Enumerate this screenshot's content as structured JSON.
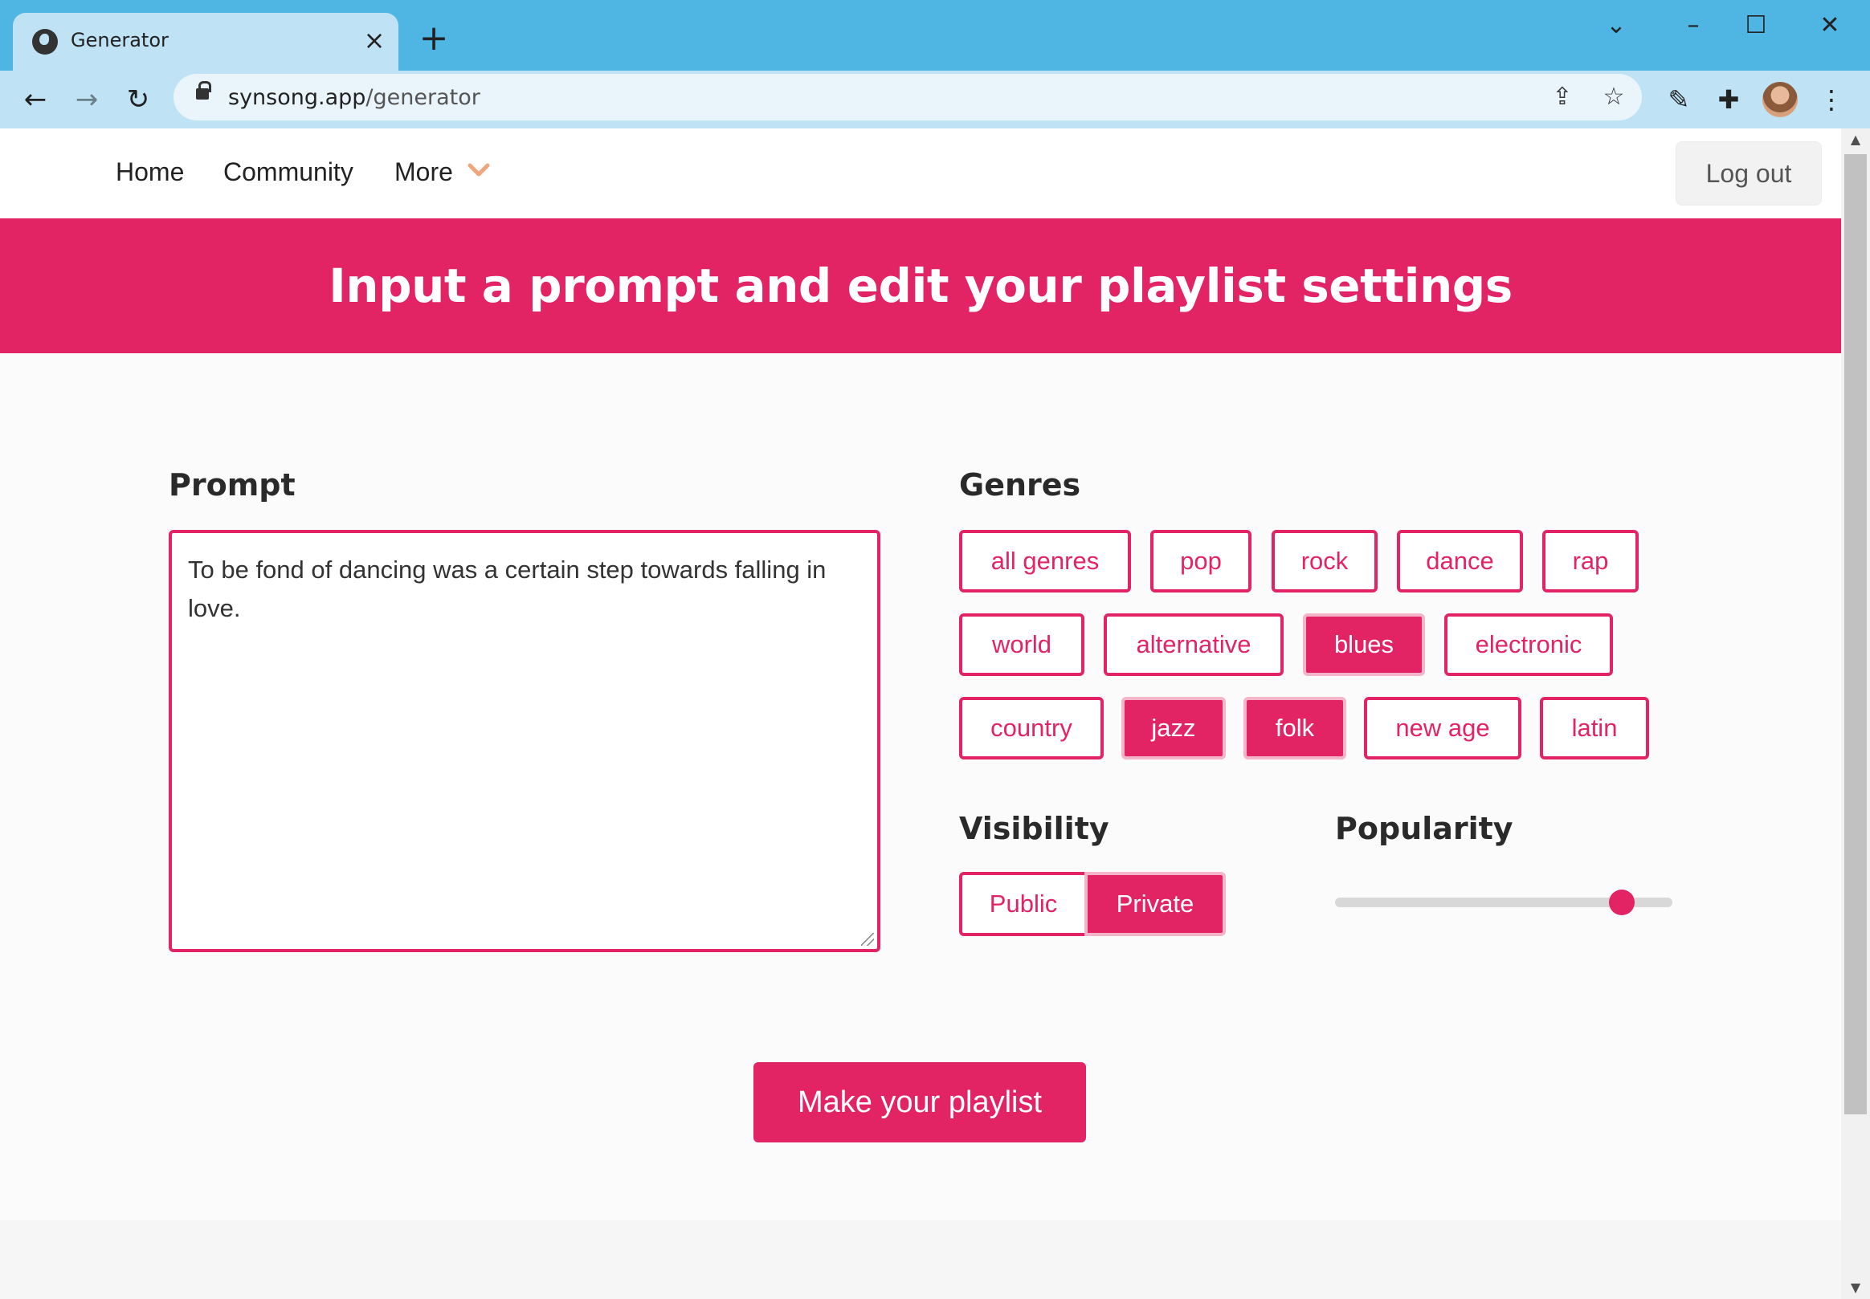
{
  "browser": {
    "tab_title": "Generator",
    "url_domain": "synsong.app",
    "url_path": "/generator"
  },
  "site": {
    "nav": {
      "home": "Home",
      "community": "Community",
      "more": "More"
    },
    "logout": "Log out",
    "banner_title": "Input a prompt and edit your playlist settings"
  },
  "prompt": {
    "label": "Prompt",
    "value": "To be fond of dancing was a certain step towards falling in love."
  },
  "genres": {
    "label": "Genres",
    "items": [
      {
        "label": "all genres",
        "selected": false
      },
      {
        "label": "pop",
        "selected": false
      },
      {
        "label": "rock",
        "selected": false
      },
      {
        "label": "dance",
        "selected": false
      },
      {
        "label": "rap",
        "selected": false
      },
      {
        "label": "world",
        "selected": false
      },
      {
        "label": "alternative",
        "selected": false
      },
      {
        "label": "blues",
        "selected": true
      },
      {
        "label": "electronic",
        "selected": false
      },
      {
        "label": "country",
        "selected": false
      },
      {
        "label": "jazz",
        "selected": true
      },
      {
        "label": "folk",
        "selected": true
      },
      {
        "label": "new age",
        "selected": false
      },
      {
        "label": "latin",
        "selected": false
      }
    ]
  },
  "visibility": {
    "label": "Visibility",
    "options": [
      "Public",
      "Private"
    ],
    "selected": "Private"
  },
  "popularity": {
    "label": "Popularity",
    "value_fraction": 0.88
  },
  "submit_label": "Make your playlist",
  "colors": {
    "accent": "#e22364",
    "chrome": "#4fb6e3",
    "chrome_light": "#bfe3f5"
  }
}
